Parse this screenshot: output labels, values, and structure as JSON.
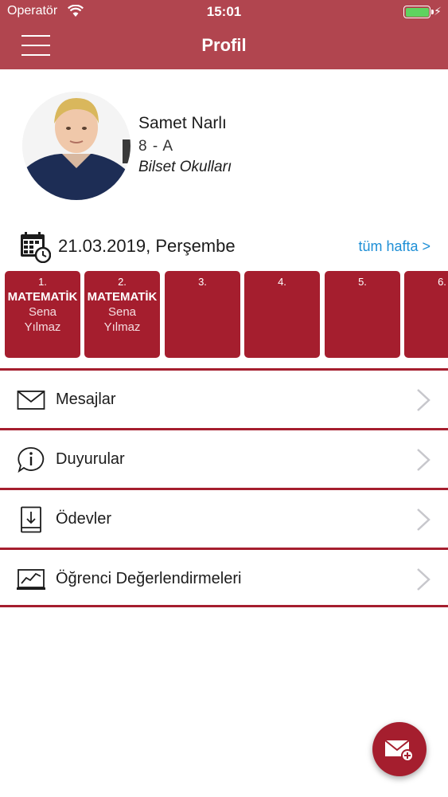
{
  "status_bar": {
    "carrier": "Operatör",
    "time": "15:01"
  },
  "header": {
    "title": "Profil"
  },
  "profile": {
    "name": "Samet Narlı",
    "class": "8 - A",
    "school": "Bilset Okulları"
  },
  "schedule": {
    "date": "21.03.2019, Perşembe",
    "week_link": "tüm hafta >",
    "lessons": [
      {
        "num": "1.",
        "subject": "MATEMATİK",
        "teacher": "Sena Yılmaz"
      },
      {
        "num": "2.",
        "subject": "MATEMATİK",
        "teacher": "Sena Yılmaz"
      },
      {
        "num": "3.",
        "subject": "",
        "teacher": ""
      },
      {
        "num": "4.",
        "subject": "",
        "teacher": ""
      },
      {
        "num": "5.",
        "subject": "",
        "teacher": ""
      },
      {
        "num": "6.",
        "subject": "",
        "teacher": ""
      }
    ]
  },
  "menu": {
    "items": [
      {
        "label": "Mesajlar",
        "icon": "envelope-icon"
      },
      {
        "label": "Duyurular",
        "icon": "info-bubble-icon"
      },
      {
        "label": "Ödevler",
        "icon": "homework-book-icon"
      },
      {
        "label": "Öğrenci Değerlendirmeleri",
        "icon": "chart-screen-icon"
      }
    ]
  },
  "colors": {
    "header": "#b1454f",
    "accent": "#a51e2e",
    "link": "#1e8fd6"
  },
  "fab": {
    "icon": "compose-message-icon"
  }
}
